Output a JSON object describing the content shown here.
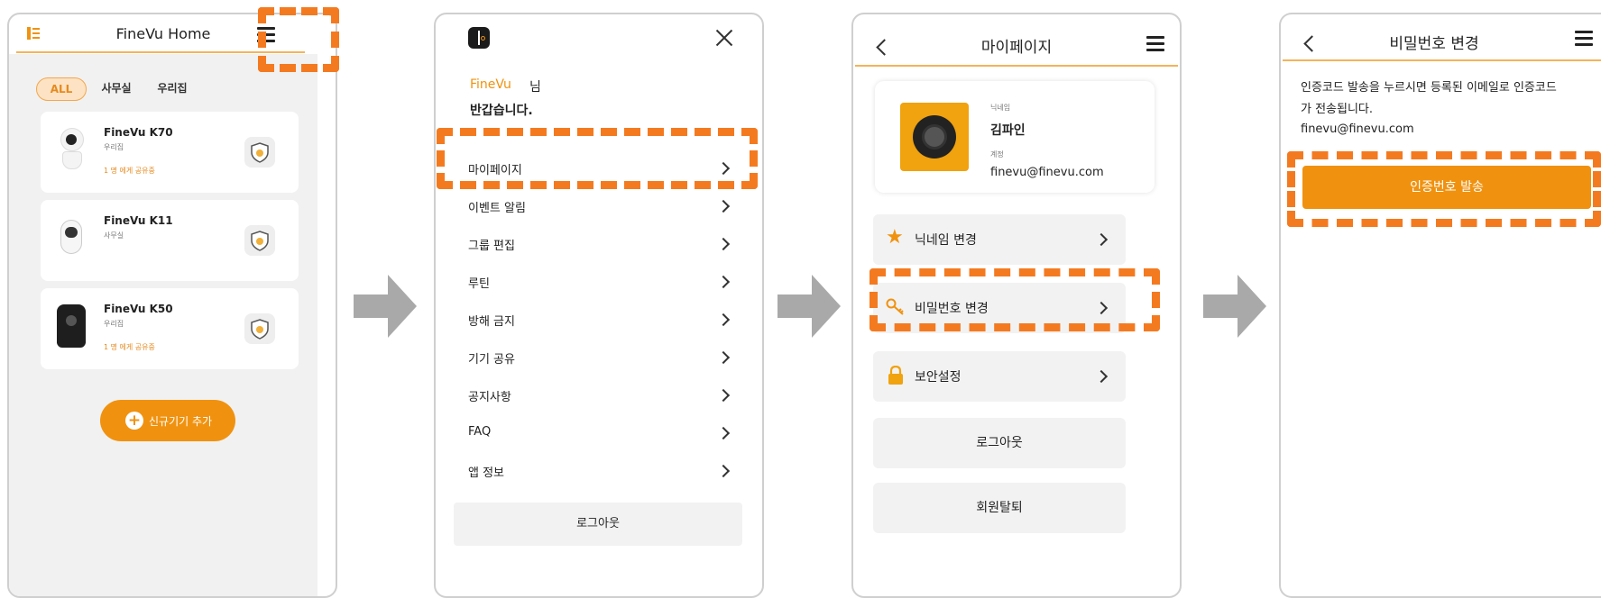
{
  "screen1": {
    "title": "FineVu Home",
    "list_icon": "list-icon",
    "menu_icon": "hamburger-menu-icon",
    "tabs": [
      {
        "label": "ALL",
        "active": true
      },
      {
        "label": "사무실",
        "active": false
      },
      {
        "label": "우리집",
        "active": false
      }
    ],
    "devices": [
      {
        "name": "FineVu K70",
        "location": "우리집",
        "shared": "1 명 에게 공유중"
      },
      {
        "name": "FineVu K11",
        "location": "사무실",
        "shared": ""
      },
      {
        "name": "FineVu K50",
        "location": "우리집",
        "shared": "1 명 에게 공유중"
      }
    ],
    "add_button": "신규기기 추가"
  },
  "screen2": {
    "brand": "FineVu",
    "honorific": "님",
    "greeting": "반갑습니다.",
    "menu_items": [
      "마이페이지",
      "이벤트 알림",
      "그룹 편집",
      "루틴",
      "방해 금지",
      "기기 공유",
      "공지사항",
      "FAQ",
      "앱 정보"
    ],
    "logout": "로그아웃"
  },
  "screen3": {
    "title": "마이페이지",
    "nickname_label": "닉네임",
    "nickname": "김파인",
    "account_label": "계정",
    "account": "finevu@finevu.com",
    "items": [
      {
        "label": "닉네임 변경",
        "icon": "star-icon"
      },
      {
        "label": "비밀번호 변경",
        "icon": "key-icon"
      },
      {
        "label": "보안설정",
        "icon": "lock-icon"
      }
    ],
    "logout": "로그아웃",
    "withdraw": "회원탈퇴"
  },
  "screen4": {
    "title": "비밀번호 변경",
    "desc_line1": "인증코드 발송을 누르시면 등록된 이메일로 인증코드",
    "desc_line2": "가 전송됩니다.",
    "email": "finevu@finevu.com",
    "send_button": "인증번호 발송"
  },
  "colors": {
    "accent": "#f0920f",
    "highlight_dash": "#f47a20",
    "arrow": "#a9a9a9",
    "panel_bg": "#f2f2f2"
  }
}
